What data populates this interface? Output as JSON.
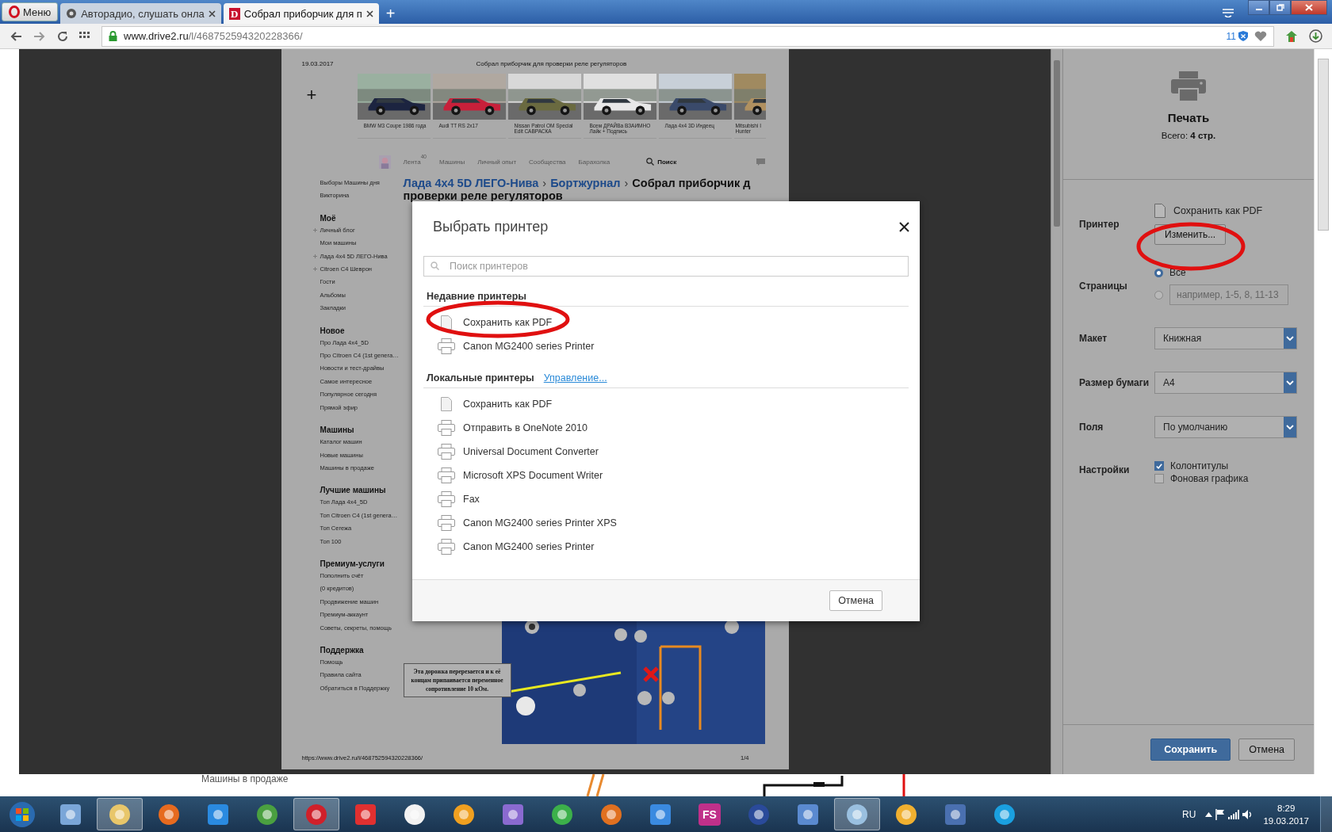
{
  "browser": {
    "menu_button": "Меню",
    "tabs": [
      {
        "title": "Авторадио, слушать онла",
        "selected": false
      },
      {
        "title": "Собрал приборчик для п",
        "selected": true,
        "favicon_letter": "D"
      }
    ],
    "new_tab": "+",
    "address": {
      "host": "www.drive2.ru",
      "path": "/l/468752594320228366/"
    },
    "shield_count": "11"
  },
  "preview": {
    "date": "19.03.2017",
    "title": "Собрал приборчик для проверки реле регуляторов",
    "add": "+",
    "cars": [
      {
        "caption": "BMW M3 Coupe 1986 года"
      },
      {
        "caption": "Audi TT RS 2x17"
      },
      {
        "caption": "Nissan Patrol OM Special Edit САВРАСКА"
      },
      {
        "caption": "Всем ДРАЙВа ВЗАИМНО Лайк + Подпись"
      },
      {
        "caption": "Лада 4х4 3D Индеец"
      },
      {
        "caption": "Mitsubishi I\nHunter"
      }
    ],
    "nav": {
      "items": [
        {
          "label": "Лента",
          "count": "40"
        },
        {
          "label": "Машины"
        },
        {
          "label": "Личный опыт"
        },
        {
          "label": "Сообщества"
        },
        {
          "label": "Барахолка"
        }
      ],
      "search": "Поиск"
    },
    "sidebar": {
      "top": [
        "Выборы Машины дня",
        "Викторина"
      ],
      "sections": [
        {
          "title": "Моё",
          "items": [
            {
              "label": "Личный блог",
              "expandable": true
            },
            {
              "label": "Мои машины",
              "expandable": false
            },
            {
              "label": "Лада 4х4 5D ЛЕГО-Нива",
              "expandable": true
            },
            {
              "label": "Citroen C4 Шеврон",
              "expandable": true
            },
            {
              "label": "Гости",
              "expandable": false
            },
            {
              "label": "Альбомы",
              "expandable": false
            },
            {
              "label": "Закладки",
              "expandable": false
            }
          ]
        },
        {
          "title": "Новое",
          "items": [
            {
              "label": "Про Лада 4х4_5D",
              "expandable": false
            },
            {
              "label": "Про Citroen C4 (1st genera…",
              "expandable": false
            },
            {
              "label": "Новости и тест-драйвы",
              "expandable": false
            },
            {
              "label": "Самое интересное",
              "expandable": false
            },
            {
              "label": "Популярное сегодня",
              "expandable": false
            },
            {
              "label": "Прямой эфир",
              "expandable": false
            }
          ]
        },
        {
          "title": "Машины",
          "items": [
            {
              "label": "Каталог машин",
              "expandable": false
            },
            {
              "label": "Новые машины",
              "expandable": false
            },
            {
              "label": "Машины в продаже",
              "expandable": false
            }
          ]
        },
        {
          "title": "Лучшие машины",
          "items": [
            {
              "label": "Топ Лада 4х4_5D",
              "expandable": false
            },
            {
              "label": "Топ Citroen C4 (1st genera…",
              "expandable": false
            },
            {
              "label": "Топ Сегежа",
              "expandable": false
            },
            {
              "label": "Топ 100",
              "expandable": false
            }
          ]
        },
        {
          "title": "Премиум-услуги",
          "items": [
            {
              "label": "Пополнить счёт\n(0 кредитов)",
              "expandable": false
            },
            {
              "label": "Продвижение машин",
              "expandable": false
            },
            {
              "label": "Премиум-аккаунт",
              "expandable": false
            },
            {
              "label": "Советы, секреты, помощь",
              "expandable": false
            }
          ]
        },
        {
          "title": "Поддержка",
          "items": [
            {
              "label": "Помощь",
              "expandable": false
            },
            {
              "label": "Правила сайта",
              "expandable": false
            },
            {
              "label": "Обратиться в Поддержку",
              "expandable": false
            }
          ]
        }
      ]
    },
    "heading": {
      "parts": [
        {
          "kind": "link",
          "text": "Лада 4х4 5D ЛЕГО-Нива"
        },
        {
          "kind": "sep",
          "text": "›"
        },
        {
          "kind": "link",
          "text": "Бортжурнал"
        },
        {
          "kind": "sep",
          "text": "›"
        },
        {
          "kind": "title",
          "text": "Собрал приборчик д"
        }
      ],
      "line2": "проверки реле регуляторов"
    },
    "figure_note": "Эта дорожка перерезается и к её концам припаивается переменное сопротивление 10 кОм.",
    "footer_url": "https://www.drive2.ru/l/468752594320228366/",
    "page_number": "1/4"
  },
  "dialog": {
    "title": "Выбрать принтер",
    "search_placeholder": "Поиск принтеров",
    "groups": [
      {
        "title": "Недавние принтеры",
        "printers": [
          {
            "name": "Сохранить как PDF",
            "kind": "pdf"
          },
          {
            "name": "Canon MG2400 series Printer",
            "kind": "printer"
          }
        ]
      },
      {
        "title": "Локальные принтеры",
        "link": "Управление...",
        "printers": [
          {
            "name": "Сохранить как PDF",
            "kind": "pdf"
          },
          {
            "name": "Отправить в OneNote 2010",
            "kind": "printer"
          },
          {
            "name": "Universal Document Converter",
            "kind": "printer"
          },
          {
            "name": "Microsoft XPS Document Writer",
            "kind": "printer"
          },
          {
            "name": "Fax",
            "kind": "printer"
          },
          {
            "name": "Canon MG2400 series Printer XPS",
            "kind": "printer"
          },
          {
            "name": "Canon MG2400 series Printer",
            "kind": "printer"
          }
        ]
      }
    ],
    "cancel": "Отмена"
  },
  "print_panel": {
    "title": "Печать",
    "total": "Всего: **4 стр.**",
    "printer": {
      "label": "Принтер",
      "name": "Сохранить как PDF",
      "change": "Изменить..."
    },
    "pages": {
      "label": "Страницы",
      "all": {
        "label": "Все",
        "selected": true
      },
      "custom": {
        "placeholder": "например, 1-5, 8, 11-13",
        "selected": false
      }
    },
    "selects": [
      {
        "label": "Макет",
        "value": "Книжная"
      },
      {
        "label": "Размер бумаги",
        "value": "A4"
      },
      {
        "label": "Поля",
        "value": "По умолчанию"
      }
    ],
    "options": {
      "label": "Настройки",
      "items": [
        {
          "label": "Колонтитулы",
          "checked": true
        },
        {
          "label": "Фоновая графика",
          "checked": false
        }
      ]
    },
    "save": "Сохранить",
    "cancel": "Отмена"
  },
  "background_text": "Машины в продаже",
  "taskbar": {
    "apps": [
      {
        "selected": false
      },
      {
        "selected": true
      },
      {
        "selected": false
      },
      {
        "selected": false
      },
      {
        "selected": false
      },
      {
        "selected": true
      },
      {
        "selected": false
      },
      {
        "selected": false
      },
      {
        "selected": false
      },
      {
        "selected": false
      },
      {
        "selected": false
      },
      {
        "selected": false
      },
      {
        "selected": false
      },
      {
        "selected": false,
        "label": "FS"
      },
      {
        "selected": false
      },
      {
        "selected": false
      },
      {
        "selected": true
      },
      {
        "selected": false
      },
      {
        "selected": false
      },
      {
        "selected": false
      }
    ],
    "language": "RU",
    "time": "8:29",
    "date": "19.03.2017"
  }
}
